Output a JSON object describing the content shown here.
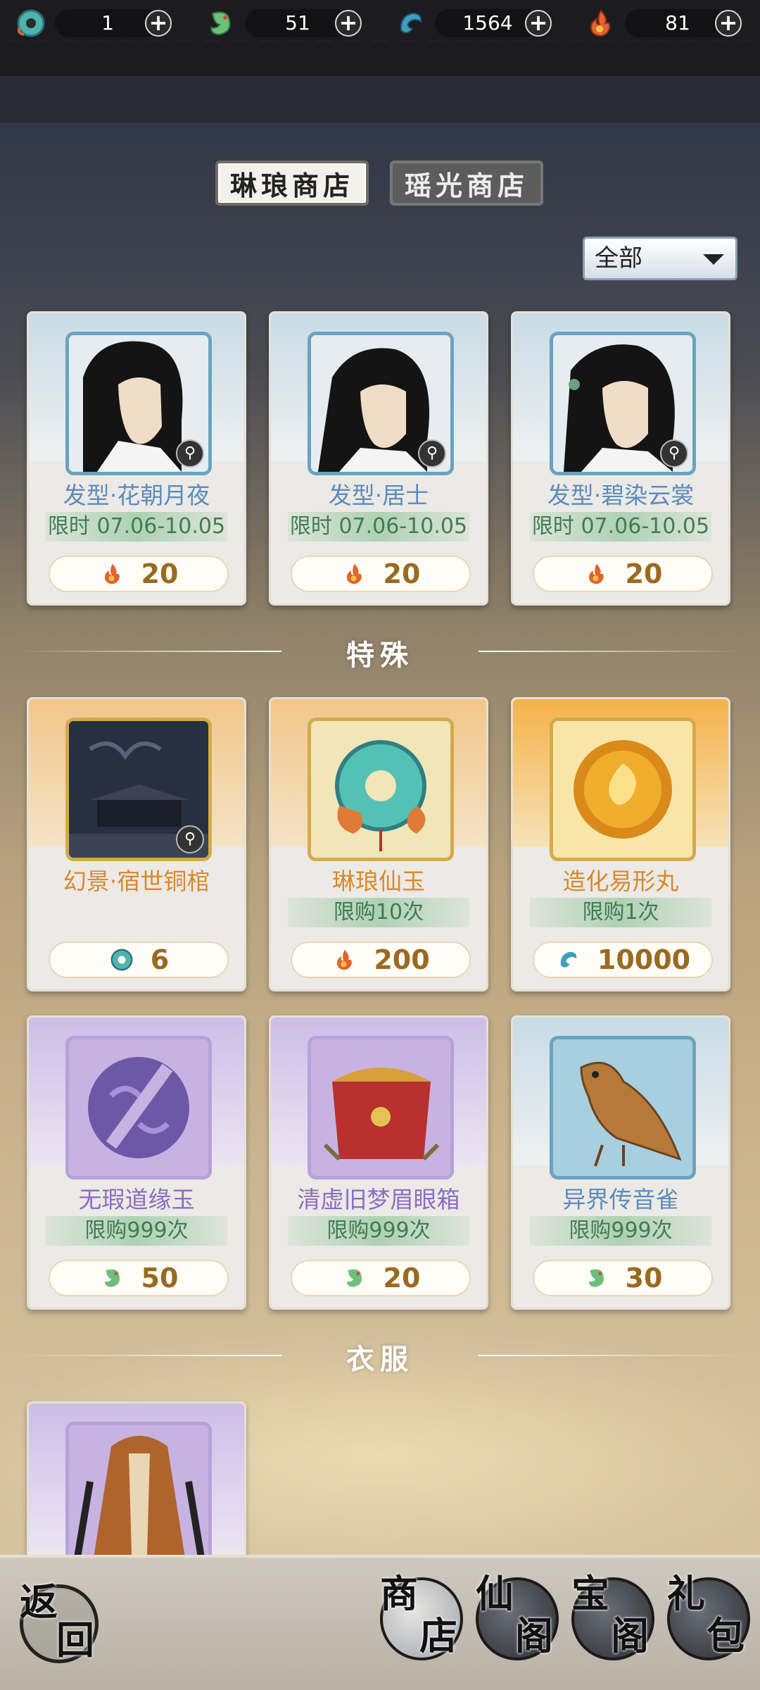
{
  "currencies": [
    {
      "icon": "jade-ring-icon",
      "value": "1"
    },
    {
      "icon": "green-token-icon",
      "value": "51"
    },
    {
      "icon": "blue-swirl-icon",
      "value": "1564"
    },
    {
      "icon": "red-flame-icon",
      "value": "81"
    }
  ],
  "tabs": {
    "active": "琳琅商店",
    "inactive": "瑶光商店"
  },
  "filter": {
    "selected": "全部"
  },
  "sections": {
    "special": "特殊",
    "clothes": "衣服"
  },
  "cards_row1": [
    {
      "name": "发型·花朝月夜",
      "limit": "限时 07.06-10.05",
      "price": "20",
      "price_icon": "red-flame-icon"
    },
    {
      "name": "发型·居士",
      "limit": "限时 07.06-10.05",
      "price": "20",
      "price_icon": "red-flame-icon"
    },
    {
      "name": "发型·碧染云裳",
      "limit": "限时 07.06-10.05",
      "price": "20",
      "price_icon": "red-flame-icon"
    }
  ],
  "cards_row2": [
    {
      "name": "幻景·宿世铜棺",
      "limit": "",
      "price": "6",
      "price_icon": "jade-ring-icon"
    },
    {
      "name": "琳琅仙玉",
      "limit": "限购10次",
      "price": "200",
      "price_icon": "red-flame-icon"
    },
    {
      "name": "造化易形丸",
      "limit": "限购1次",
      "price": "10000",
      "price_icon": "blue-swirl-icon"
    }
  ],
  "cards_row3": [
    {
      "name": "无瑕道缘玉",
      "limit": "限购999次",
      "price": "50",
      "price_icon": "green-token-icon"
    },
    {
      "name": "清虚旧梦眉眼箱",
      "limit": "限购999次",
      "price": "20",
      "price_icon": "green-token-icon"
    },
    {
      "name": "异界传音雀",
      "limit": "限购999次",
      "price": "30",
      "price_icon": "green-token-icon"
    }
  ],
  "bottom_nav": {
    "back": {
      "c1": "返",
      "c2": "回"
    },
    "shop": {
      "c1": "商",
      "c2": "店"
    },
    "xiange": {
      "c1": "仙",
      "c2": "阁"
    },
    "baoge": {
      "c1": "宝",
      "c2": "阁"
    },
    "libao": {
      "c1": "礼",
      "c2": "包"
    }
  },
  "colors": {
    "price_text": "#9a6a22",
    "limit_text": "#3f7c52",
    "blue_name": "#5b8cbe",
    "orange_name": "#d9892a",
    "purple_name": "#8c6cc4"
  }
}
